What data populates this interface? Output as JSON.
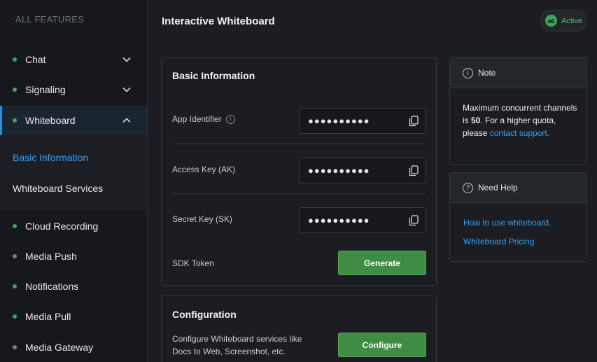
{
  "sidebar": {
    "header": "ALL FEATURES",
    "items": [
      {
        "label": "Chat"
      },
      {
        "label": "Signaling"
      },
      {
        "label": "Whiteboard"
      },
      {
        "label": "Cloud Recording"
      },
      {
        "label": "Media Push"
      },
      {
        "label": "Notifications"
      },
      {
        "label": "Media Pull"
      },
      {
        "label": "Media Gateway"
      }
    ],
    "sub_items": [
      {
        "label": "Basic Information"
      },
      {
        "label": "Whiteboard Services"
      }
    ]
  },
  "header": {
    "title": "Interactive Whiteboard",
    "status": "Active"
  },
  "basic_info": {
    "title": "Basic Information",
    "fields": [
      {
        "label": "App Identifier",
        "value": "●●●●●●●●●●"
      },
      {
        "label": "Access Key (AK)",
        "value": "●●●●●●●●●●"
      },
      {
        "label": "Secret Key (SK)",
        "value": "●●●●●●●●●●"
      }
    ],
    "sdk_token_label": "SDK Token",
    "generate_label": "Generate"
  },
  "configuration": {
    "title": "Configuration",
    "description": "Configure Whiteboard services like Docs to Web, Screenshot, etc.",
    "button_label": "Configure"
  },
  "note": {
    "title": "Note",
    "text_before": "Maximum concurrent channels is ",
    "text_bold": "50",
    "text_after": ". For a higher quota, please ",
    "link": "contact support."
  },
  "help": {
    "title": "Need Help",
    "links": [
      "How to use whiteboard.",
      "Whiteboard Pricing"
    ]
  },
  "colors": {
    "accent_blue": "#3a9cf0",
    "success_green": "#3fa65a",
    "button_green": "#3f8d44"
  }
}
